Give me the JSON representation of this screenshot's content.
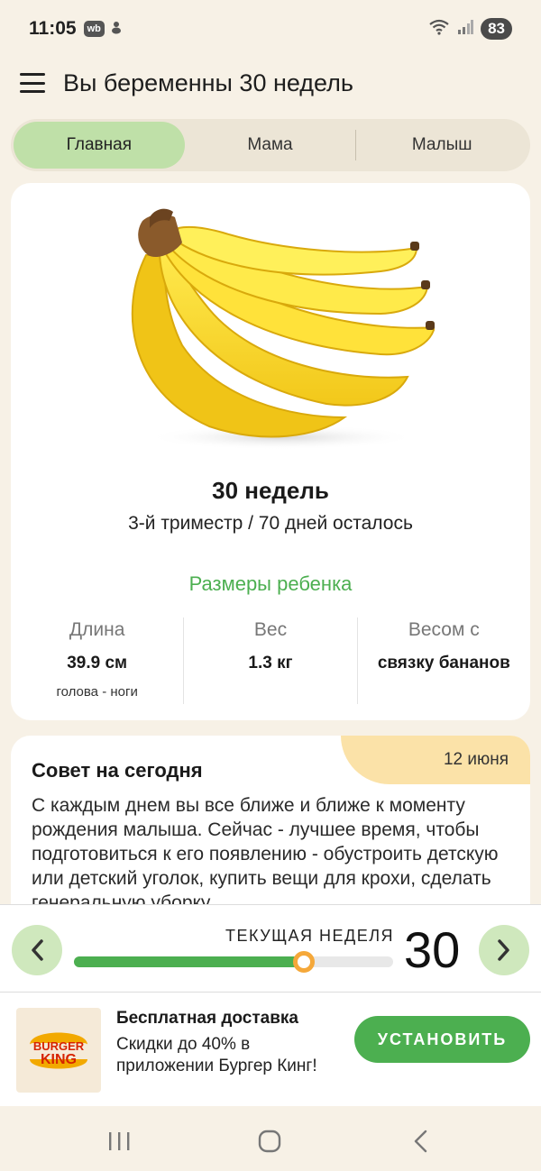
{
  "status_bar": {
    "time": "11:05",
    "app_badge": "wb",
    "battery": "83"
  },
  "header": {
    "title": "Вы беременны 30 недель"
  },
  "tabs": [
    {
      "label": "Главная",
      "active": true
    },
    {
      "label": "Мама",
      "active": false
    },
    {
      "label": "Малыш",
      "active": false
    }
  ],
  "week_card": {
    "title": "30 недель",
    "subtitle": "3-й триместр / 70 дней осталось",
    "sizes_title": "Размеры ребенка",
    "stats": [
      {
        "label": "Длина",
        "value": "39.9 см",
        "note": "голова - ноги"
      },
      {
        "label": "Вес",
        "value": "1.3 кг",
        "note": ""
      },
      {
        "label": "Весом с",
        "value": "связку бананов",
        "note": ""
      }
    ]
  },
  "tip_card": {
    "title": "Совет на сегодня",
    "date": "12 июня",
    "text": "С каждым днем вы все ближе и ближе к моменту рождения малыша. Сейчас - лучшее время, чтобы подготовиться к его появлению - обустроить детскую или детский уголок, купить вещи для крохи, сделать генеральную уборку"
  },
  "week_selector": {
    "label": "ТЕКУЩАЯ НЕДЕЛЯ",
    "week": "30",
    "progress_fraction": 0.72
  },
  "ad": {
    "brand_line1": "BURGER",
    "brand_line2": "KING",
    "title": "Бесплатная доставка",
    "text": "Скидки до 40% в приложении Бургер Кинг!",
    "button": "УСТАНОВИТЬ"
  },
  "colors": {
    "accent_green": "#4caf50",
    "tab_active": "#bfe0a8",
    "knob_orange": "#f5a83a",
    "background": "#f7f1e6"
  },
  "icons": [
    "menu-icon",
    "chevron-left-icon",
    "chevron-right-icon",
    "wifi-icon",
    "signal-icon",
    "recent-apps-icon",
    "home-icon",
    "back-icon"
  ]
}
